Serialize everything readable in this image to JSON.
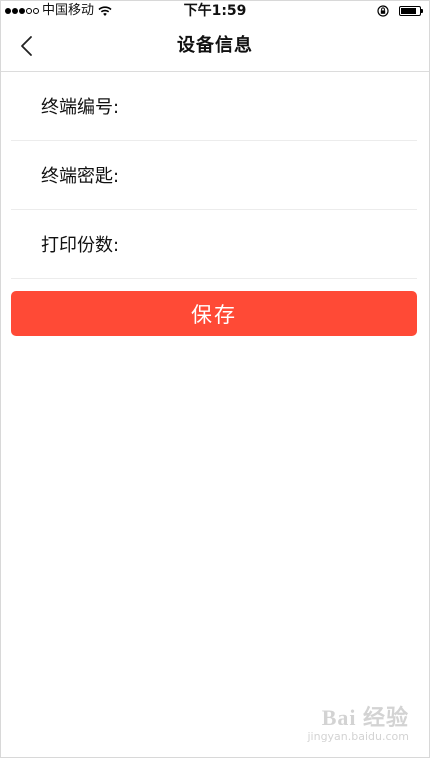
{
  "status_bar": {
    "carrier": "中国移动",
    "time": "下午1:59",
    "battery_level": 0.85
  },
  "nav": {
    "title": "设备信息"
  },
  "form": {
    "fields": [
      {
        "label": "终端编号:",
        "value": ""
      },
      {
        "label": "终端密匙:",
        "value": ""
      },
      {
        "label": "打印份数:",
        "value": ""
      }
    ]
  },
  "actions": {
    "save_label": "保存"
  },
  "watermark": {
    "logo_text": "Bai 经验",
    "url": "jingyan.baidu.com"
  },
  "colors": {
    "accent": "#ff4a36",
    "divider": "#ececec"
  }
}
